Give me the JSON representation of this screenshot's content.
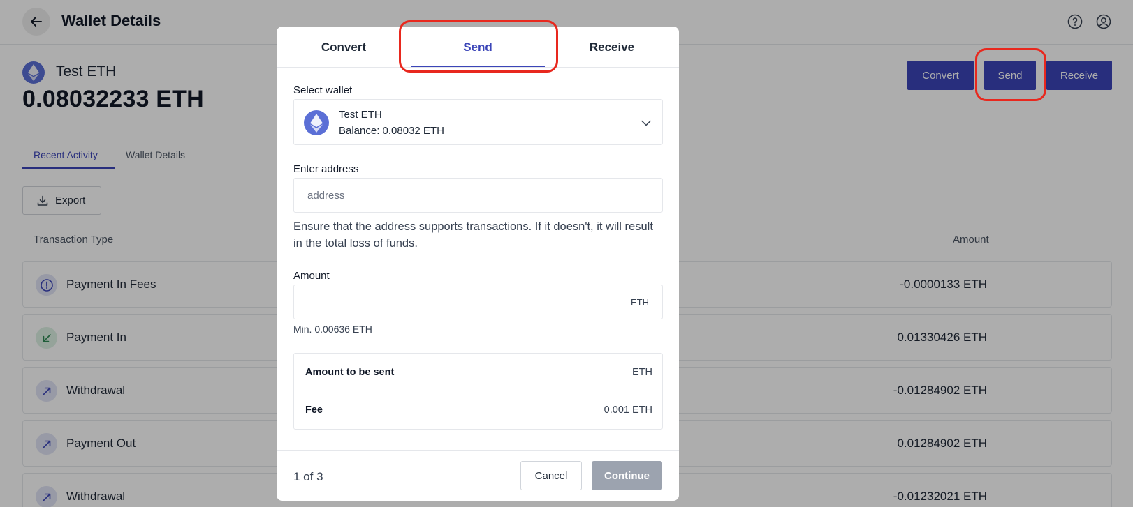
{
  "header": {
    "title": "Wallet Details",
    "back_icon": "arrow-left-icon",
    "help_icon": "help-circle-icon",
    "user_icon": "user-circle-icon"
  },
  "wallet": {
    "name": "Test ETH",
    "balance": "0.08032233 ETH",
    "icon": "ethereum-icon"
  },
  "actions": {
    "convert": "Convert",
    "send": "Send",
    "receive": "Receive"
  },
  "tabs": {
    "recent": "Recent Activity",
    "details": "Wallet Details"
  },
  "export_label": "Export",
  "table": {
    "col_type": "Transaction Type",
    "col_amount": "Amount",
    "rows": [
      {
        "type": "Payment In Fees",
        "amount": "-0.0000133 ETH",
        "icon": "alert-circle-icon"
      },
      {
        "type": "Payment In",
        "amount": "0.01330426 ETH",
        "icon": "arrow-down-left-icon"
      },
      {
        "type": "Withdrawal",
        "amount": "-0.01284902 ETH",
        "icon": "arrow-up-right-icon"
      },
      {
        "type": "Payment Out",
        "amount": "0.01284902 ETH",
        "icon": "arrow-up-right-icon"
      },
      {
        "type": "Withdrawal",
        "amount": "-0.01232021 ETH",
        "icon": "arrow-up-right-icon"
      }
    ]
  },
  "modal": {
    "tabs": {
      "convert": "Convert",
      "send": "Send",
      "receive": "Receive"
    },
    "active_tab": "Send",
    "select_wallet_label": "Select wallet",
    "selected_wallet": {
      "name": "Test ETH",
      "balance": "Balance: 0.08032 ETH"
    },
    "address_label": "Enter address",
    "address_placeholder": "address",
    "address_value": "",
    "warning": "Ensure that the address supports transactions. If it doesn't, it will result in the total loss of funds.",
    "amount_label": "Amount",
    "amount_unit": "ETH",
    "min_amount": "Min. 0.00636 ETH",
    "summary": {
      "amount_label": "Amount to be sent",
      "amount_value": "ETH",
      "fee_label": "Fee",
      "fee_value": "0.001 ETH"
    },
    "step": "1 of 3",
    "cancel": "Cancel",
    "continue": "Continue"
  },
  "colors": {
    "accent": "#3b45b8",
    "highlight": "#e8281e",
    "eth": "#5b6fd6",
    "disabled": "#9ca3af"
  }
}
